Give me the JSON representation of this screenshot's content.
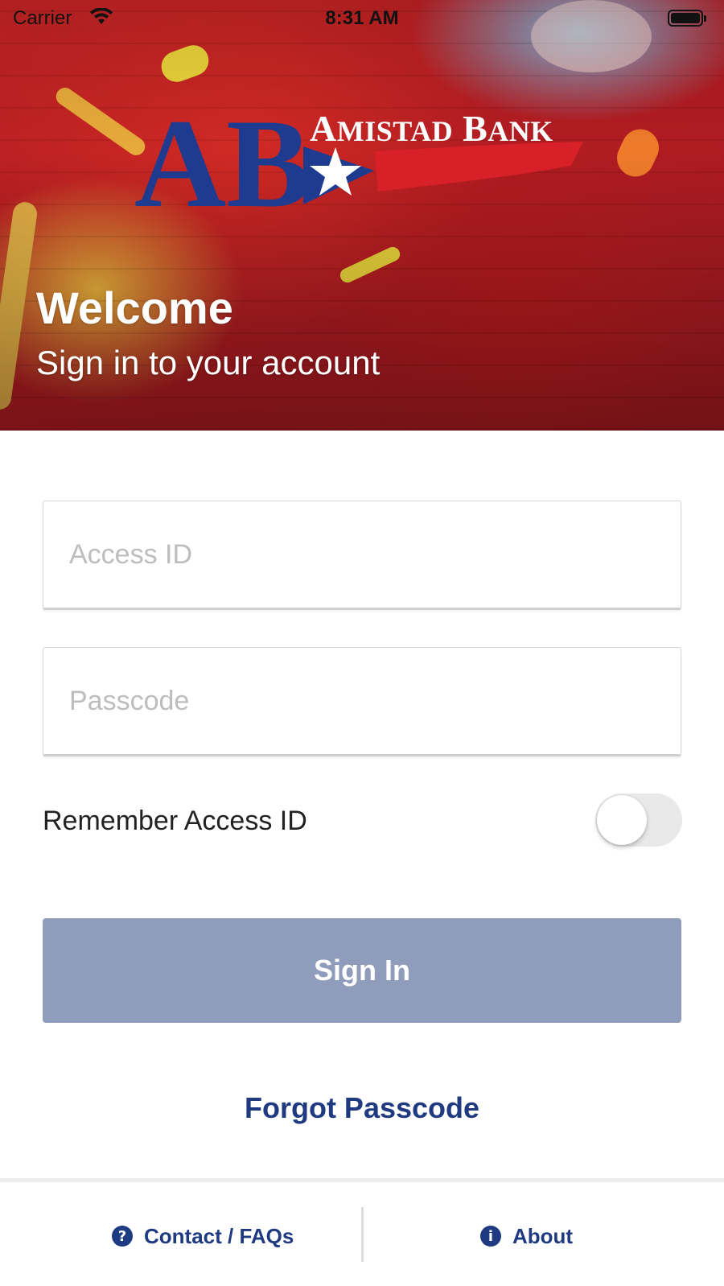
{
  "status_bar": {
    "carrier": "Carrier",
    "time": "8:31 AM"
  },
  "brand": {
    "monogram": "AB",
    "name_first_initial": "A",
    "name_first_rest": "MISTAD",
    "name_second_initial": "B",
    "name_second_rest": "ANK",
    "colors": {
      "blue": "#1f3b8f",
      "red": "#d72027",
      "white": "#ffffff"
    }
  },
  "hero": {
    "title": "Welcome",
    "subtitle": "Sign in to your account"
  },
  "form": {
    "access_id_placeholder": "Access ID",
    "passcode_placeholder": "Passcode",
    "remember_label": "Remember Access ID",
    "remember_enabled": false,
    "signin_label": "Sign In",
    "forgot_label": "Forgot Passcode"
  },
  "footer": {
    "contact": {
      "label": "Contact / FAQs",
      "icon": "question-circle-icon",
      "glyph": "?"
    },
    "about": {
      "label": "About",
      "icon": "info-circle-icon",
      "glyph": "i"
    }
  },
  "colors": {
    "primary": "#1f3a80",
    "button_disabled": "#8f9cbb",
    "toggle_off": "#e9e9ea",
    "field_border": "#d7d7d7",
    "placeholder": "#bdbdbd"
  }
}
